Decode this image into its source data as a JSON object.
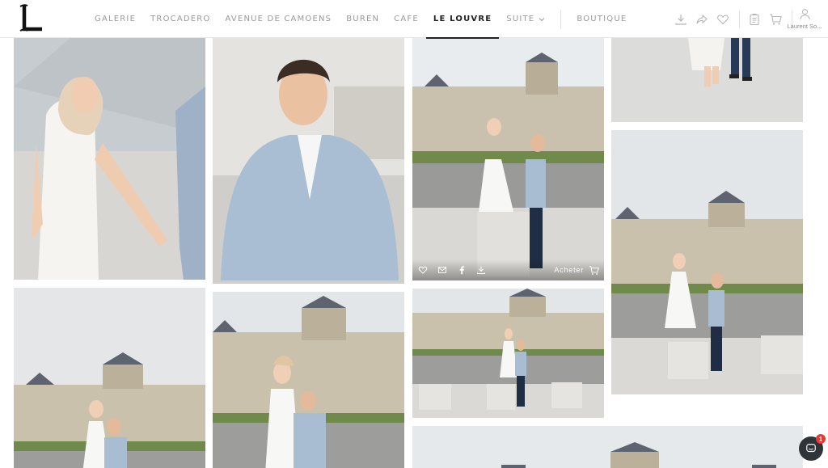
{
  "brand": {
    "logo_letter": "L"
  },
  "nav": {
    "items": [
      {
        "label": "GALERIE"
      },
      {
        "label": "TROCADERO"
      },
      {
        "label": "AVENUE DE CAMOENS"
      },
      {
        "label": "BUREN"
      },
      {
        "label": "CAFE"
      },
      {
        "label": "LE LOUVRE"
      },
      {
        "label": "SUITE"
      }
    ],
    "active": "LE LOUVRE",
    "boutique_label": "BOUTIQUE"
  },
  "toolbar": {
    "icons": [
      "download-icon",
      "share-icon",
      "heart-icon",
      "clipboard-icon",
      "cart-icon"
    ]
  },
  "user": {
    "name": "Laurent So..."
  },
  "gallery": {
    "hover_actions": [
      "heart-icon",
      "mail-icon",
      "facebook-icon",
      "download-icon"
    ],
    "buy_label": "Acheter"
  },
  "chat": {
    "badge_count": "1"
  },
  "colors": {
    "accent": "#222222",
    "nav_inactive": "#9a9a9a",
    "chat_bg": "#2f3439",
    "badge": "#e53935"
  }
}
